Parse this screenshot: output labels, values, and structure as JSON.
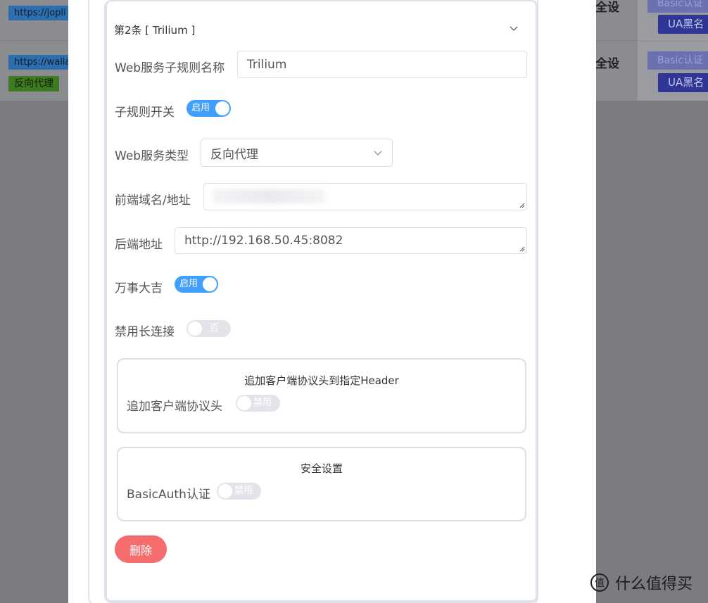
{
  "background": {
    "row1": {
      "url": "https://jopli",
      "right_text": "全设",
      "basic": "Basic认证",
      "ua": "UA黑名"
    },
    "row2": {
      "url": "https://walla",
      "tag": "反向代理",
      "right_text": "全设",
      "basic": "Basic认证",
      "ua": "UA黑名"
    }
  },
  "rule": {
    "header": "第2条 [ Trilium ]",
    "name_label": "Web服务子规则名称",
    "name_value": "Trilium",
    "switch_label": "子规则开关",
    "switch_text": "启用",
    "type_label": "Web服务类型",
    "type_value": "反向代理",
    "frontend_label": "前端域名/地址",
    "frontend_value": "",
    "backend_label": "后端地址",
    "backend_value": "http://192.168.50.45:8082",
    "wanshi_label": "万事大吉",
    "wanshi_text": "启用",
    "keepalive_label": "禁用长连接",
    "keepalive_text": "否"
  },
  "header_section": {
    "title": "追加客户端协议头到指定Header",
    "label": "追加客户端协议头",
    "switch_text": "禁用"
  },
  "security_section": {
    "title": "安全设置",
    "label": "BasicAuth认证",
    "switch_text": "禁用"
  },
  "delete_label": "删除",
  "watermark": "什么值得买",
  "colors": {
    "primary": "#409eff",
    "danger": "#f56c6c",
    "switch_off": "#e2e4e9"
  }
}
